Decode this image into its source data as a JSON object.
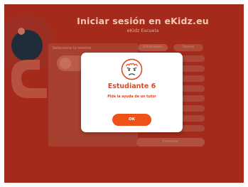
{
  "background": {
    "title": "Iniciar sesión en eKidz.eu",
    "subtitle": "eKidz Escuela",
    "panel_label": "Selecciona tu nombre",
    "tabs": [
      "Estudiantes",
      "Tutores"
    ],
    "bottom_button": "Continuar",
    "logo_icon": "ekidz-logo-icon"
  },
  "modal": {
    "icon": "student-face-icon",
    "student_name": "Estudiante 6",
    "message": "Pide la ayuda de un tutor",
    "ok_label": "OK"
  },
  "colors": {
    "overlay": "#a42a1c",
    "accent": "#ee5218",
    "text_accent": "#e2461e",
    "modal_bg": "#ffffff"
  }
}
